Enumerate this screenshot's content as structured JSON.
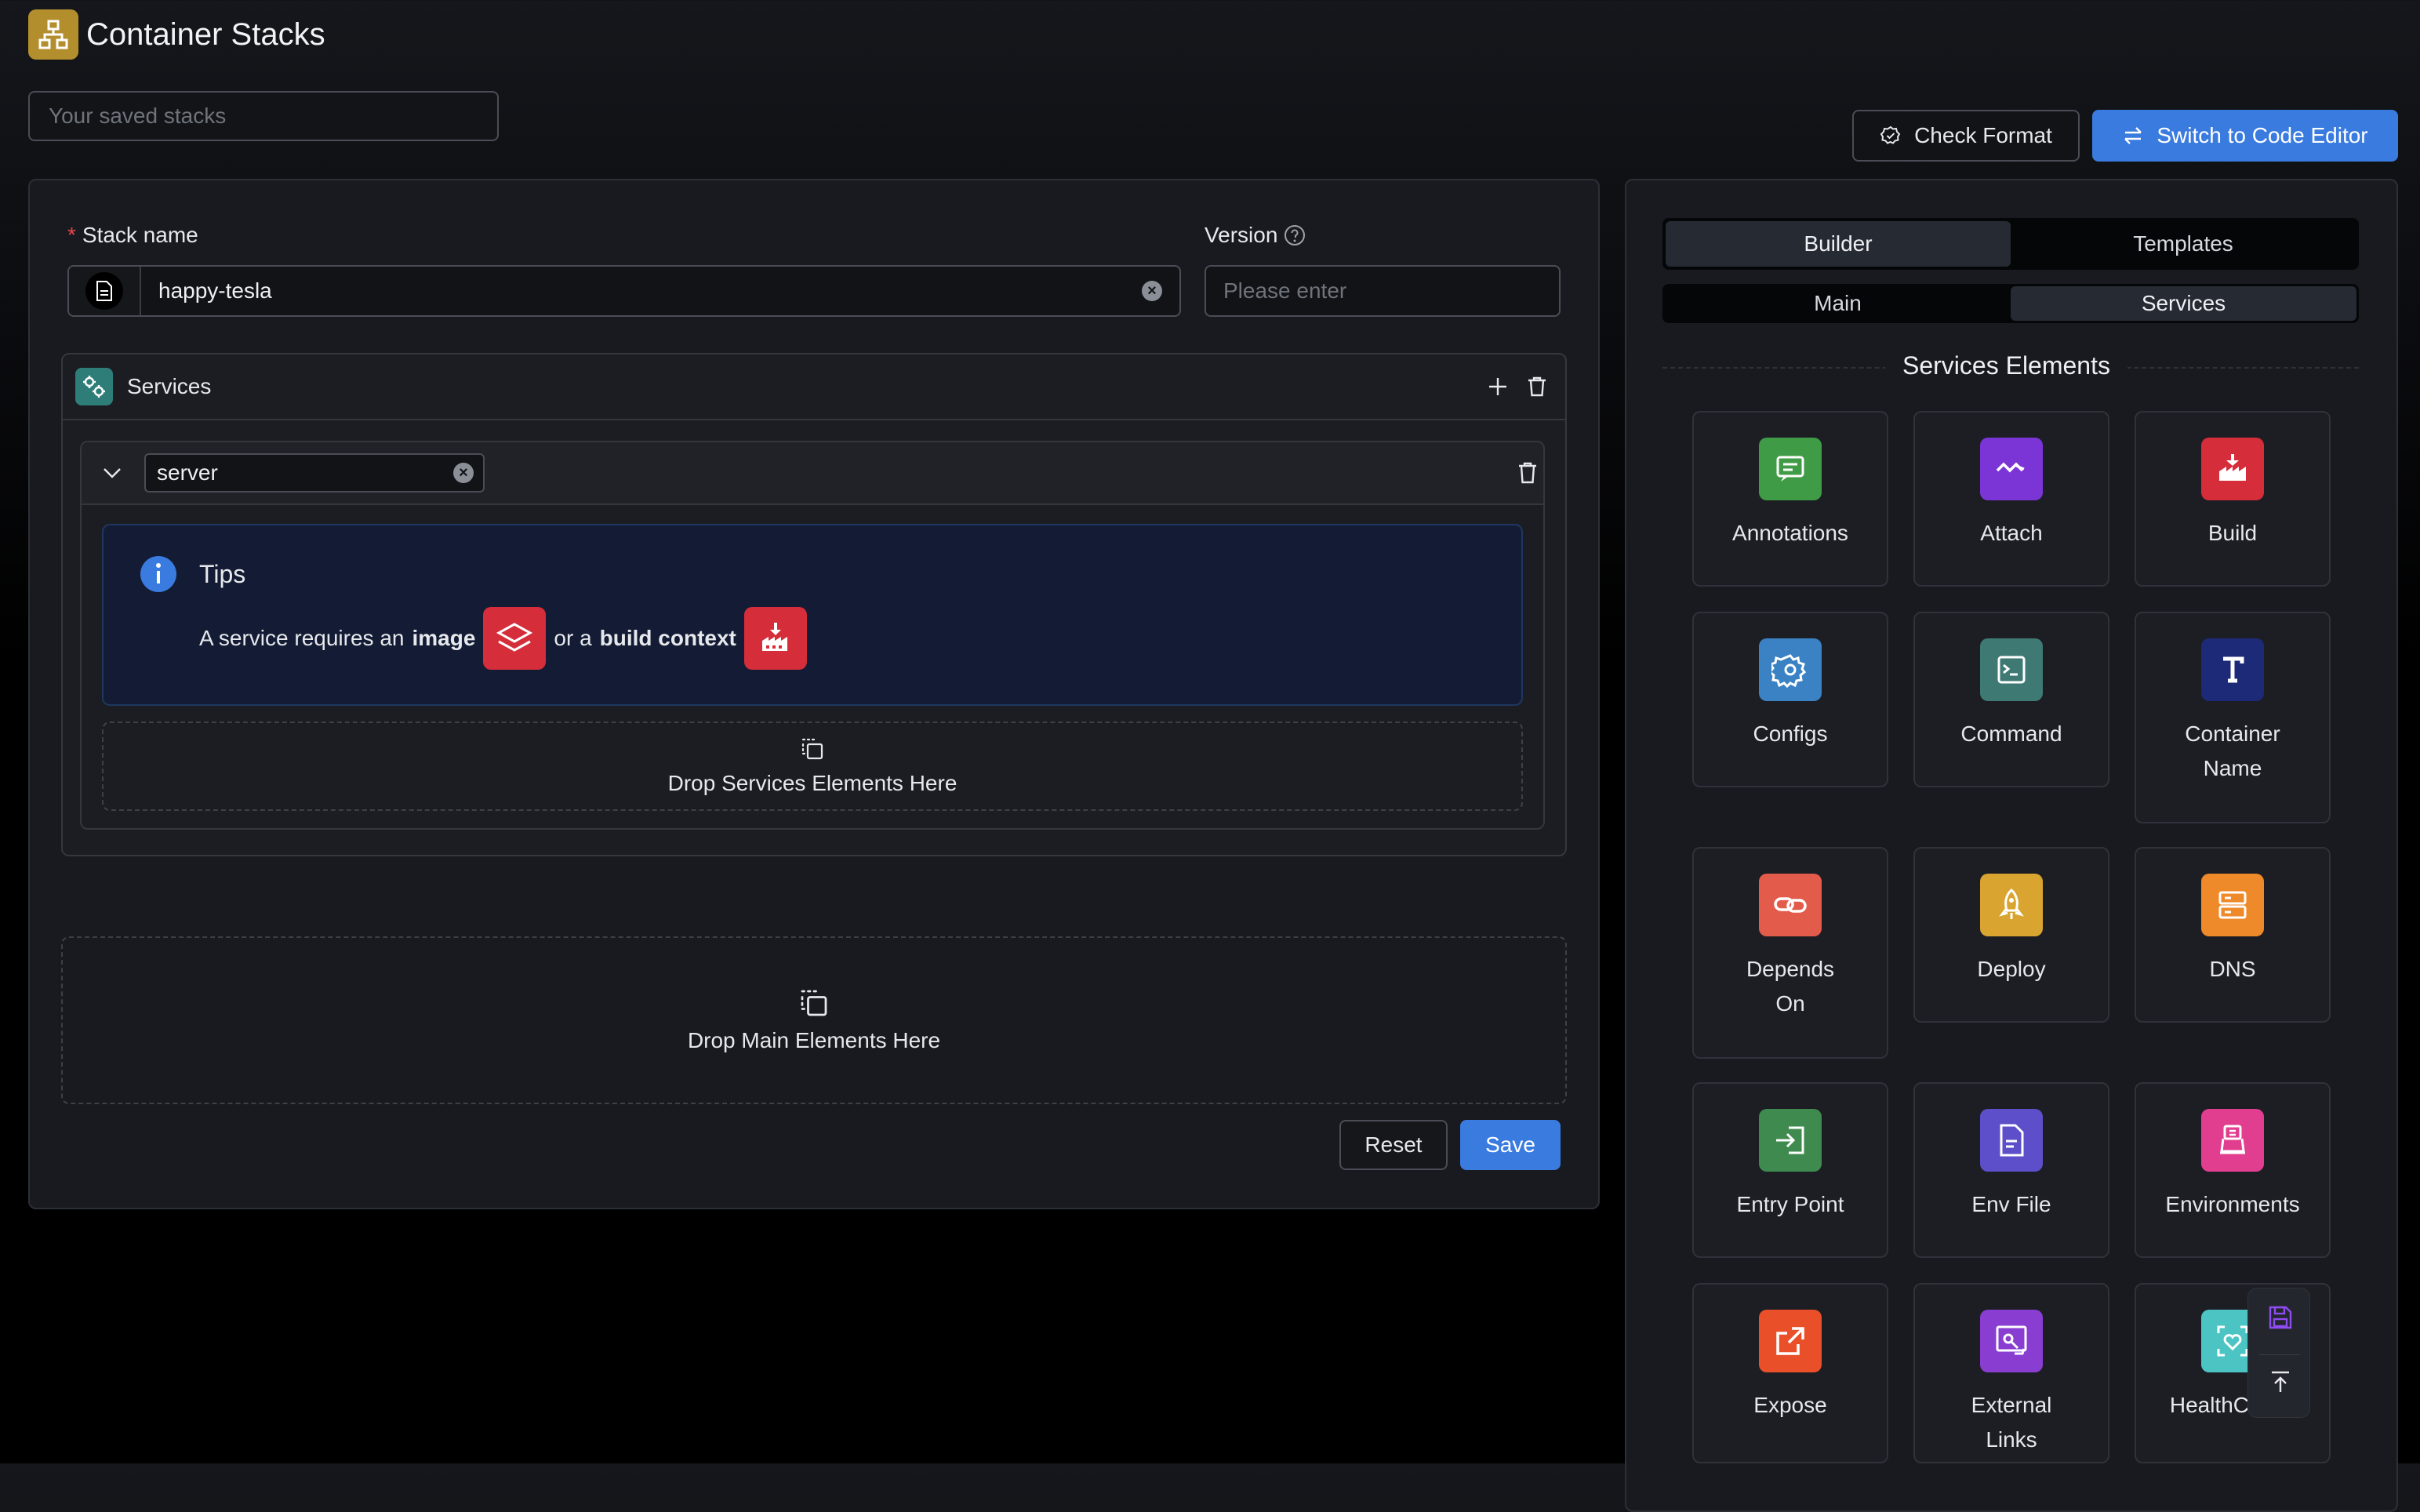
{
  "header": {
    "title": "Container Stacks"
  },
  "saved_stacks": {
    "placeholder": "Your saved stacks"
  },
  "toolbar": {
    "check_format": "Check Format",
    "switch_editor": "Switch to Code Editor"
  },
  "form": {
    "stack_name_label": "Stack name",
    "required_mark": "*",
    "stack_name_value": "happy-tesla",
    "version_label": "Version",
    "version_placeholder": "Please enter"
  },
  "services": {
    "title": "Services",
    "service_name": "server",
    "tips": {
      "title": "Tips",
      "text_prefix": "A service requires an",
      "image_word": "image",
      "middle": "or a",
      "build_word": "build context"
    },
    "drop_services": "Drop Services Elements Here"
  },
  "drop_main": "Drop Main Elements Here",
  "actions": {
    "reset": "Reset",
    "save": "Save"
  },
  "sidebar": {
    "tabs": [
      "Builder",
      "Templates"
    ],
    "subtabs": [
      "Main",
      "Services"
    ],
    "section_title": "Services Elements",
    "elements": [
      {
        "label": "Annotations",
        "color": "#3f9b45",
        "icon": "message-icon"
      },
      {
        "label": "Attach",
        "color": "#7b35d6",
        "icon": "attach-icon"
      },
      {
        "label": "Build",
        "color": "#d52d3a",
        "icon": "build-icon"
      },
      {
        "label": "Configs",
        "color": "#3b82c4",
        "icon": "gear-icon"
      },
      {
        "label": "Command",
        "color": "#3e7a73",
        "icon": "terminal-icon"
      },
      {
        "label": "Container Name",
        "color": "#1c2a78",
        "icon": "text-icon"
      },
      {
        "label": "Depends On",
        "color": "#e35b4a",
        "icon": "link-icon"
      },
      {
        "label": "Deploy",
        "color": "#d9a530",
        "icon": "rocket-icon"
      },
      {
        "label": "DNS",
        "color": "#ee8a2a",
        "icon": "server-icon"
      },
      {
        "label": "Entry Point",
        "color": "#3f8a4e",
        "icon": "entry-icon"
      },
      {
        "label": "Env File",
        "color": "#5c4fc9",
        "icon": "file-icon"
      },
      {
        "label": "Environments",
        "color": "#e23e8f",
        "icon": "environments-icon"
      },
      {
        "label": "Expose",
        "color": "#e9502a",
        "icon": "external-icon"
      },
      {
        "label": "External Links",
        "color": "#8a3dd1",
        "icon": "external-links-icon"
      },
      {
        "label": "HealthCheck",
        "color": "#4dc4c4",
        "icon": "health-icon"
      }
    ]
  }
}
